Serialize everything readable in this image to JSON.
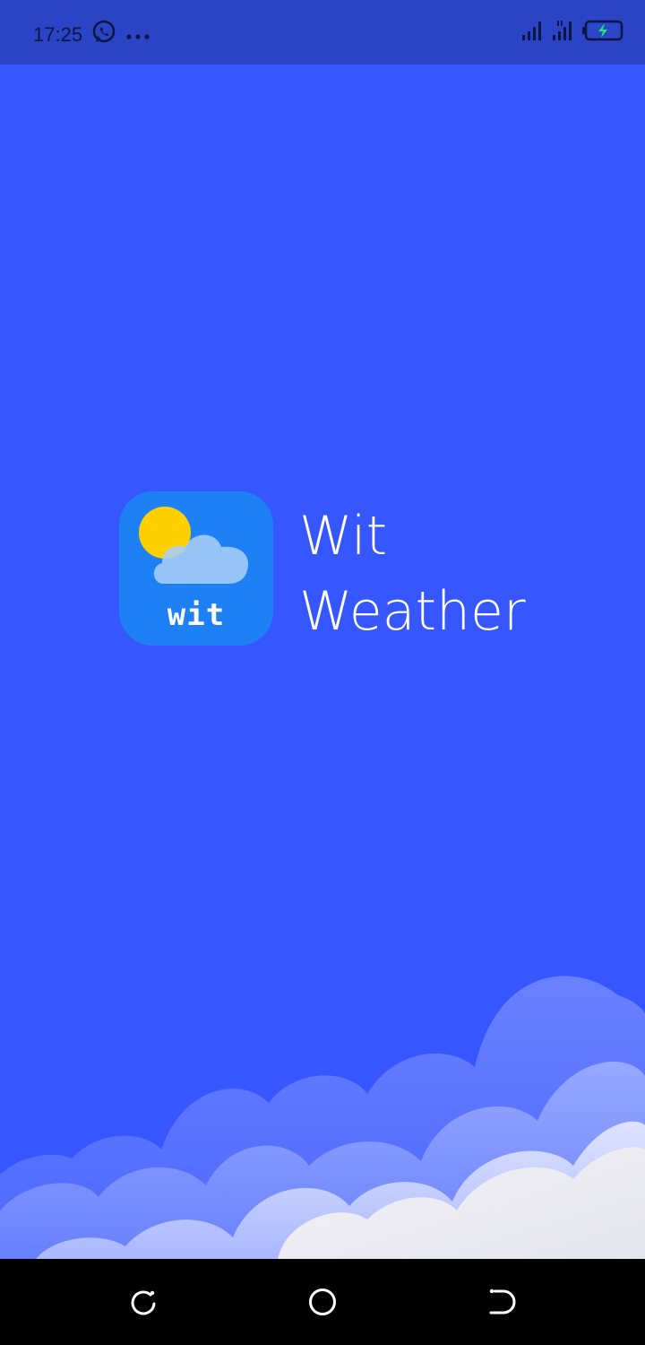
{
  "status_bar": {
    "time": "17:25",
    "notification_icons": [
      "whatsapp-icon",
      "more-dots-icon"
    ],
    "system_icons": [
      "signal-icon",
      "signal-hd-icon",
      "battery-charging-icon"
    ],
    "colors": {
      "background": "#2b44c5",
      "text": "#0b1642"
    }
  },
  "splash": {
    "icon_wordmark": "wit",
    "app_name_line1": "Wit",
    "app_name_line2": "Weather",
    "colors": {
      "background": "#3657ff",
      "icon_background": "#1e80f5",
      "sun": "#ffd000",
      "cloud": "#a9cdf7"
    }
  },
  "nav_bar": {
    "buttons": [
      "recent-apps-icon",
      "home-icon",
      "back-icon"
    ]
  }
}
